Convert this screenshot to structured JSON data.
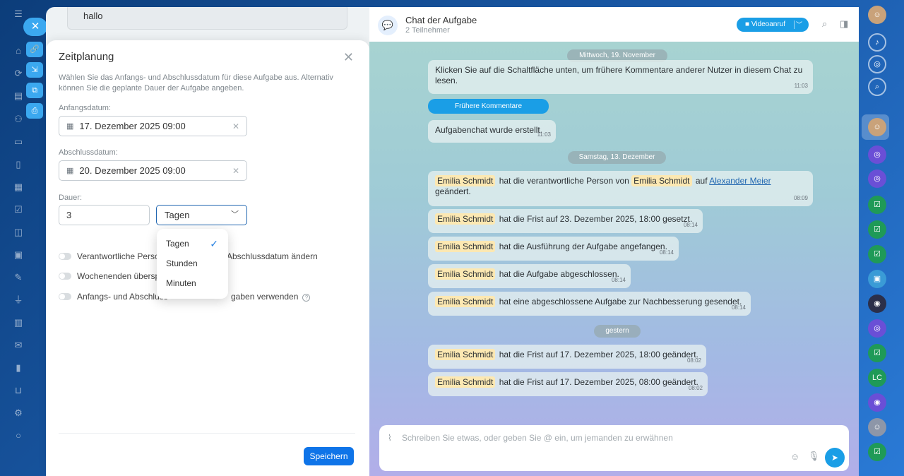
{
  "task_panel": {
    "description_snippet": "hallo"
  },
  "modal": {
    "title": "Zeitplanung",
    "description": "Wählen Sie das Anfangs- und Abschlussdatum für diese Aufgabe aus. Alternativ können Sie die geplante Dauer der Aufgabe angeben.",
    "start_label": "Anfangsdatum:",
    "start_value": "17. Dezember 2025 09:00",
    "end_label": "Abschlussdatum:",
    "end_value": "20. Dezember 2025 09:00",
    "duration_label": "Dauer:",
    "duration_value": "3",
    "duration_unit": "Tagen",
    "toggle_1_left": "Verantwortliche Person",
    "toggle_1_right": "Abschlussdatum ändern",
    "toggle_2": "Wochenenden überspri",
    "toggle_3_left": "Anfangs- und Abschluss",
    "toggle_3_right": "gaben verwenden",
    "save": "Speichern"
  },
  "dropdown": {
    "options": [
      "Tagen",
      "Stunden",
      "Minuten"
    ],
    "selected": "Tagen"
  },
  "chat": {
    "title": "Chat der Aufgabe",
    "subtitle": "2 Teilnehmer",
    "video_call": "Videoanruf",
    "earlier_comments": "Frühere Kommentare",
    "composer_placeholder": "Schreiben Sie etwas, oder geben Sie @ ein, um jemanden zu erwähnen",
    "date_1": "Mittwoch, 19. November",
    "date_2": "Samstag, 13. Dezember",
    "date_3": "gestern",
    "messages": [
      {
        "text": "Klicken Sie auf die Schaltfläche unten, um frühere Kommentare anderer Nutzer in diesem Chat zu lesen.",
        "time": "11:03"
      },
      {
        "text": "Aufgabenchat wurde erstellt.",
        "time": "11:03"
      },
      {
        "mention": "Emilia Schmidt",
        "text": "hat die verantwortliche Person von",
        "mention2": "Emilia Schmidt",
        "text2": "auf",
        "link": "Alexander Meier",
        "text3": "geändert.",
        "time": "08:09"
      },
      {
        "mention": "Emilia Schmidt",
        "text": "hat die Frist auf 23. Dezember 2025, 18:00 gesetzt.",
        "time": "08:14"
      },
      {
        "mention": "Emilia Schmidt",
        "text": "hat die Ausführung der Aufgabe angefangen.",
        "time": "08:14"
      },
      {
        "mention": "Emilia Schmidt",
        "text": "hat die Aufgabe abgeschlossen.",
        "time": "08:14"
      },
      {
        "mention": "Emilia Schmidt",
        "text": "hat eine abgeschlossene Aufgabe zur Nachbesserung gesendet.",
        "time": "08:14"
      },
      {
        "mention": "Emilia Schmidt",
        "text": "hat die Frist auf 17. Dezember 2025, 18:00 geändert.",
        "time": "08:02"
      },
      {
        "mention": "Emilia Schmidt",
        "text": "hat die Frist auf 17. Dezember 2025, 08:00 geändert.",
        "time": "08:02"
      }
    ]
  },
  "right_rail": {
    "initials": "LC"
  },
  "icons": {
    "close": "close-icon",
    "link": "link-icon",
    "download": "download-icon",
    "external": "external-link-icon",
    "print": "print-icon",
    "calendar": "calendar-icon",
    "chevron": "chevron-down-icon",
    "check": "check-icon",
    "search": "search-icon",
    "send": "send-icon",
    "mic": "mic-icon",
    "emoji": "emoji-icon",
    "attach": "attach-icon"
  },
  "colors": {
    "accent": "#1a9ee6",
    "primary_button": "#0f74e8",
    "mention_bg": "#fce8b2"
  }
}
